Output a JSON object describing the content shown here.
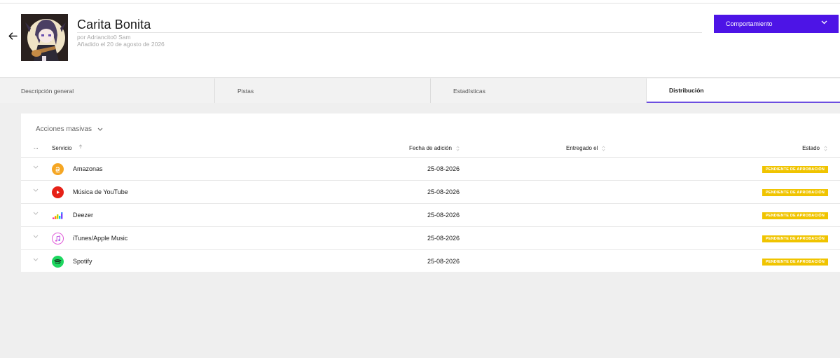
{
  "release": {
    "title": "Carita Bonita",
    "artist_line": "por Adriancito0 Sam",
    "added_line": "Añadido el 20 de agosto de 2026"
  },
  "actions": {
    "dropdown_label": "Comportamiento"
  },
  "tabs": [
    {
      "label": "Descripción general",
      "active": false
    },
    {
      "label": "Pistas",
      "active": false
    },
    {
      "label": "Estadísticas",
      "active": false
    },
    {
      "label": "Distribución",
      "active": true
    }
  ],
  "distribution": {
    "bulk_actions": "Acciones masivas",
    "columns": {
      "select": "...",
      "service": "Servicio",
      "date_added": "Fecha de adición",
      "delivered": "Entregado el",
      "status": "Estado"
    },
    "rows": [
      {
        "service": "Amazonas",
        "icon": "amazon-icon",
        "date": "25-08-2026",
        "delivered": "",
        "status": "PENDIENTE DE APROBACIÓN"
      },
      {
        "service": "Música de YouTube",
        "icon": "youtube-music-icon",
        "date": "25-08-2026",
        "delivered": "",
        "status": "PENDIENTE DE APROBACIÓN"
      },
      {
        "service": "Deezer",
        "icon": "deezer-icon",
        "date": "25-08-2026",
        "delivered": "",
        "status": "PENDIENTE DE APROBACIÓN"
      },
      {
        "service": "iTunes/Apple Music",
        "icon": "itunes-icon",
        "date": "25-08-2026",
        "delivered": "",
        "status": "PENDIENTE DE APROBACIÓN"
      },
      {
        "service": "Spotify",
        "icon": "spotify-icon",
        "date": "25-08-2026",
        "delivered": "",
        "status": "PENDIENTE DE APROBACIÓN"
      }
    ]
  },
  "colors": {
    "accent": "#4d14e6",
    "tab_underline": "#6c4ee0",
    "pending_badge": "#f0c400",
    "amazon": "#f5a623",
    "youtube": "#e62117",
    "spotify": "#1ed760"
  }
}
